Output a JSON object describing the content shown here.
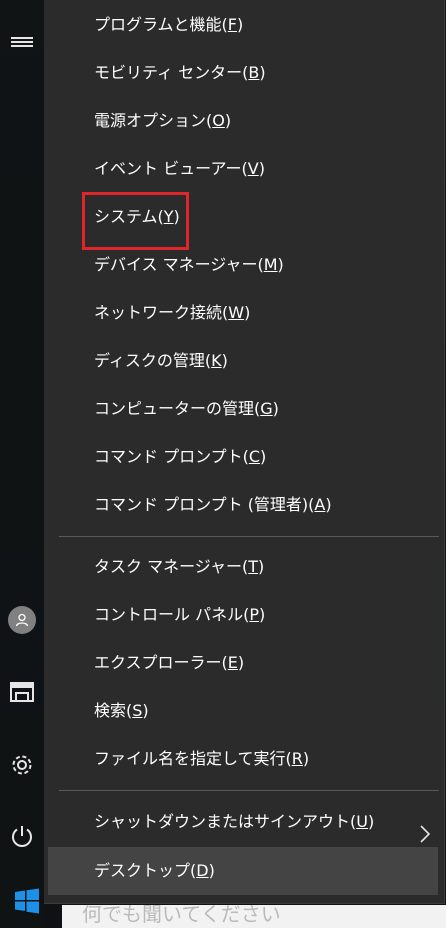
{
  "menu": {
    "group1": [
      {
        "text": "プログラムと機能(",
        "key": "F",
        "end": ")"
      },
      {
        "text": "モビリティ センター(",
        "key": "B",
        "end": ")"
      },
      {
        "text": "電源オプション(",
        "key": "O",
        "end": ")"
      },
      {
        "text": "イベント ビューアー(",
        "key": "V",
        "end": ")"
      },
      {
        "text": "システム(",
        "key": "Y",
        "end": ")"
      },
      {
        "text": "デバイス マネージャー(",
        "key": "M",
        "end": ")"
      },
      {
        "text": "ネットワーク接続(",
        "key": "W",
        "end": ")"
      },
      {
        "text": "ディスクの管理(",
        "key": "K",
        "end": ")"
      },
      {
        "text": "コンピューターの管理(",
        "key": "G",
        "end": ")"
      },
      {
        "text": "コマンド プロンプト(",
        "key": "C",
        "end": ")"
      },
      {
        "text": "コマンド プロンプト (管理者)(",
        "key": "A",
        "end": ")"
      }
    ],
    "group2": [
      {
        "text": "タスク マネージャー(",
        "key": "T",
        "end": ")"
      },
      {
        "text": "コントロール パネル(",
        "key": "P",
        "end": ")"
      },
      {
        "text": "エクスプローラー(",
        "key": "E",
        "end": ")"
      },
      {
        "text": "検索(",
        "key": "S",
        "end": ")"
      },
      {
        "text": "ファイル名を指定して実行(",
        "key": "R",
        "end": ")"
      }
    ],
    "group3": [
      {
        "text": "シャットダウンまたはサインアウト(",
        "key": "U",
        "end": ")"
      },
      {
        "text": "デスクトップ(",
        "key": "D",
        "end": ")"
      }
    ]
  },
  "search_hint": "何でも聞いてください",
  "colors": {
    "menu_bg": "#2b2b2b",
    "hover_bg": "#444444",
    "highlight": "#e0262b",
    "windows_logo": "#1e90e8"
  },
  "icons": [
    "hamburger-icon",
    "user-icon",
    "file-explorer-icon",
    "settings-gear-icon",
    "power-icon",
    "windows-logo-icon",
    "chevron-right-icon"
  ]
}
